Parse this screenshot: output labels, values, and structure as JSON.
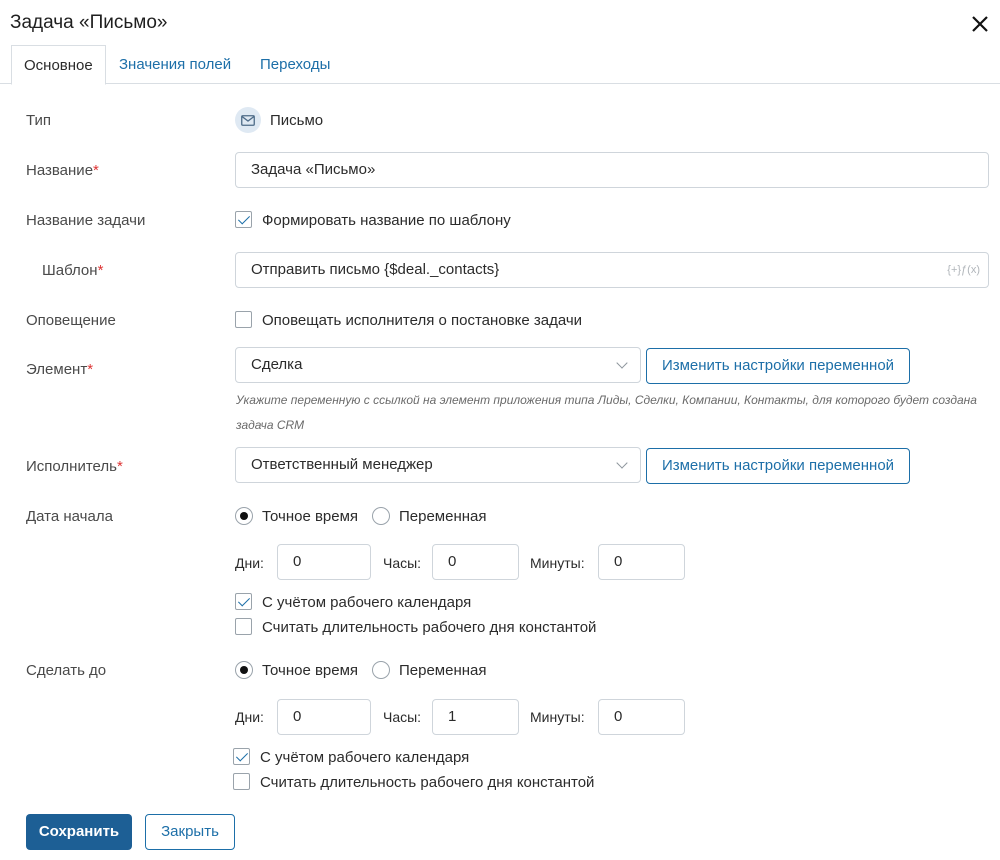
{
  "window": {
    "title": "Задача «Письмо»",
    "close_icon": "close-icon"
  },
  "tabs": [
    {
      "label": "Основное",
      "active": true
    },
    {
      "label": "Значения полей",
      "active": false
    },
    {
      "label": "Переходы",
      "active": false
    }
  ],
  "form": {
    "type": {
      "label": "Тип",
      "value": "Письмо",
      "icon": "envelope-icon"
    },
    "name": {
      "label": "Название",
      "required_mark": "*",
      "value": "Задача «Письмо»"
    },
    "task_name": {
      "label": "Название задачи",
      "checkbox_label": "Формировать название по шаблону",
      "checked": true
    },
    "template": {
      "label": "Шаблон",
      "required_mark": "*",
      "value": "Отправить письмо {$deal._contacts}",
      "fx_label": "{+}ƒ(x)"
    },
    "notification": {
      "label": "Оповещение",
      "checkbox_label": "Оповещать исполнителя о постановке задачи",
      "checked": false
    },
    "element": {
      "label": "Элемент",
      "required_mark": "*",
      "value": "Сделка",
      "button": "Изменить настройки переменной",
      "hint_line1": "Укажите переменную с ссылкой на элемент приложения типа Лиды, Сделки, Компании, Контакты, для которого будет создана",
      "hint_line2": "задача CRM"
    },
    "assignee": {
      "label": "Исполнитель",
      "required_mark": "*",
      "value": "Ответственный менеджер",
      "button": "Изменить настройки переменной"
    },
    "start_date": {
      "label": "Дата начала",
      "radio_exact": "Точное время",
      "radio_variable": "Переменная",
      "selected": "exact",
      "days_label": "Дни:",
      "days": "0",
      "hours_label": "Часы:",
      "hours": "0",
      "minutes_label": "Минуты:",
      "minutes": "0",
      "calendar_label": "С учётом рабочего календаря",
      "calendar_checked": true,
      "constant_label": "Считать длительность рабочего дня константой",
      "constant_checked": false
    },
    "due_date": {
      "label": "Сделать до",
      "radio_exact": "Точное время",
      "radio_variable": "Переменная",
      "selected": "exact",
      "days_label": "Дни:",
      "days": "0",
      "hours_label": "Часы:",
      "hours": "1",
      "minutes_label": "Минуты:",
      "minutes": "0",
      "calendar_label": "С учётом рабочего календаря",
      "calendar_checked": true,
      "constant_label": "Считать длительность рабочего дня константой",
      "constant_checked": false
    }
  },
  "footer": {
    "save": "Сохранить",
    "close": "Закрыть"
  }
}
